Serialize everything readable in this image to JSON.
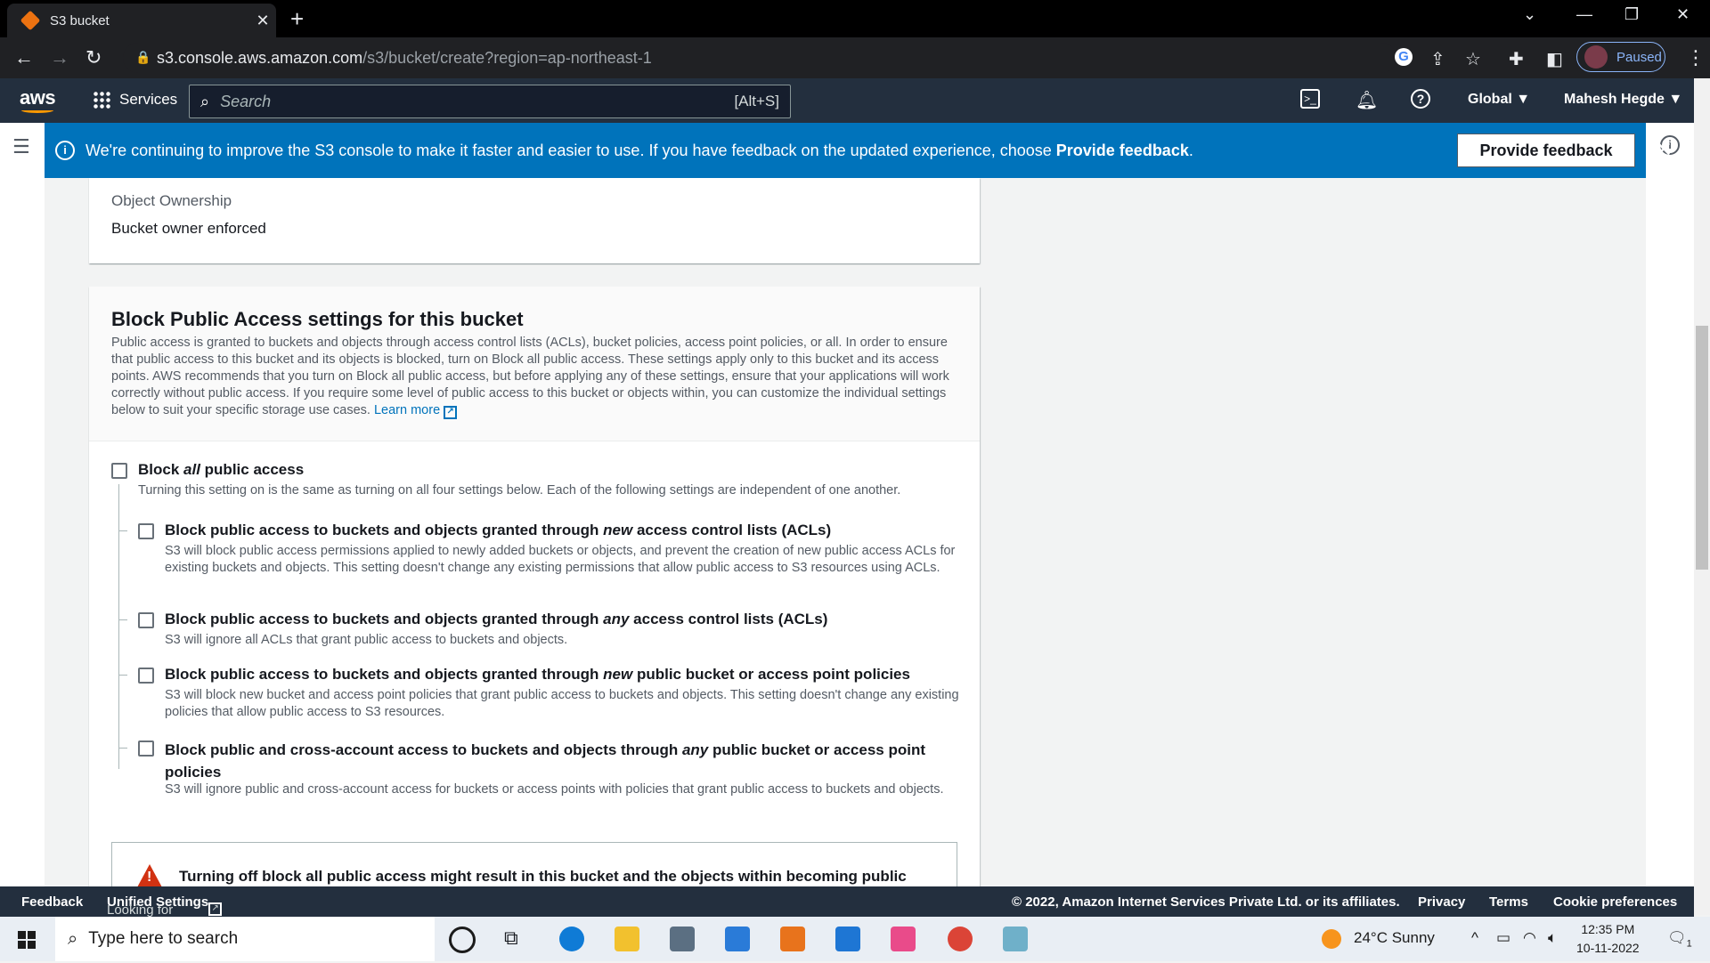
{
  "browser": {
    "tab_title": "S3 bucket",
    "url_host": "s3.console.aws.amazon.com",
    "url_path": "/s3/bucket/create?region=ap-northeast-1",
    "profile_status": "Paused"
  },
  "aws_nav": {
    "logo": "aws",
    "services_label": "Services",
    "search_placeholder": "Search",
    "search_shortcut": "[Alt+S]",
    "region": "Global ▼",
    "user": "Mahesh Hegde ▼"
  },
  "banner": {
    "message_part1": "We're continuing to improve the S3 console to make it faster and easier to use. If you have feedback on the updated experience, choose ",
    "message_bold": "Provide feedback",
    "message_end": ".",
    "button_label": "Provide feedback"
  },
  "ownership": {
    "label": "Object Ownership",
    "value": "Bucket owner enforced"
  },
  "block_public_access": {
    "title": "Block Public Access settings for this bucket",
    "description": "Public access is granted to buckets and objects through access control lists (ACLs), bucket policies, access point policies, or all. In order to ensure that public access to this bucket and its objects is blocked, turn on Block all public access. These settings apply only to this bucket and its access points. AWS recommends that you turn on Block all public access, but before applying any of these settings, ensure that your applications will work correctly without public access. If you require some level of public access to this bucket or objects within, you can customize the individual settings below to suit your specific storage use cases.",
    "learn_more": "Learn more",
    "block_all": {
      "title_pre": "Block ",
      "title_em": "all",
      "title_post": " public access",
      "desc": "Turning this setting on is the same as turning on all four settings below. Each of the following settings are independent of one another."
    },
    "options": [
      {
        "title_pre": "Block public access to buckets and objects granted through ",
        "title_em": "new",
        "title_post": " access control lists (ACLs)",
        "desc": "S3 will block public access permissions applied to newly added buckets or objects, and prevent the creation of new public access ACLs for existing buckets and objects. This setting doesn't change any existing permissions that allow public access to S3 resources using ACLs."
      },
      {
        "title_pre": "Block public access to buckets and objects granted through ",
        "title_em": "any",
        "title_post": " access control lists (ACLs)",
        "desc": "S3 will ignore all ACLs that grant public access to buckets and objects."
      },
      {
        "title_pre": "Block public access to buckets and objects granted through ",
        "title_em": "new",
        "title_post": " public bucket or access point policies",
        "desc": "S3 will block new bucket and access point policies that grant public access to buckets and objects. This setting doesn't change any existing policies that allow public access to S3 resources."
      },
      {
        "title_pre": "Block public and cross-account access to buckets and objects through ",
        "title_em": "any",
        "title_post": " public bucket or access point policies",
        "desc": "S3 will ignore public and cross-account access for buckets or access points with policies that grant public access to buckets and objects."
      }
    ],
    "warning": "Turning off block all public access might result in this bucket and the objects within becoming public"
  },
  "footer": {
    "feedback": "Feedback",
    "lang_text": "Looking for language selection? Find it in the new ",
    "unified": "Unified Settings",
    "copyright": "© 2022, Amazon Internet Services Private Ltd. or its affiliates.",
    "privacy": "Privacy",
    "terms": "Terms",
    "cookie": "Cookie preferences"
  },
  "taskbar": {
    "search_placeholder": "Type here to search",
    "weather": "24°C  Sunny",
    "time": "12:35 PM",
    "date": "10-11-2022",
    "notification_count": "1"
  },
  "colors": {
    "aws_nav": "#232f3e",
    "banner": "#0073bb",
    "accent_orange": "#ff9900"
  }
}
